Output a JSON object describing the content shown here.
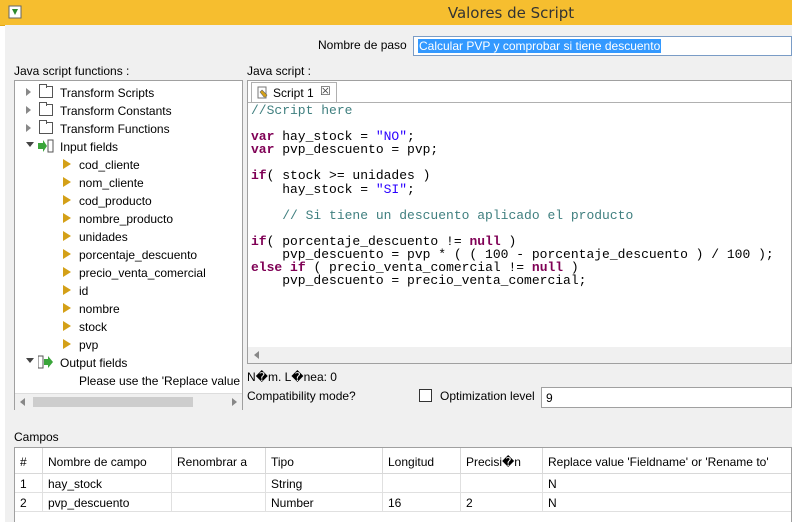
{
  "window": {
    "title": "Valores de Script"
  },
  "step": {
    "name_label": "Nombre de paso",
    "name_value": "Calcular PVP y comprobar si tiene descuento"
  },
  "functions": {
    "label": "Java script functions :",
    "tree": [
      {
        "label": "Transform Scripts",
        "kind": "folder"
      },
      {
        "label": "Transform Constants",
        "kind": "folder"
      },
      {
        "label": "Transform Functions",
        "kind": "folder"
      },
      {
        "label": "Input fields",
        "kind": "input"
      }
    ],
    "input_fields": [
      "cod_cliente",
      "nom_cliente",
      "cod_producto",
      "nombre_producto",
      "unidades",
      "porcentaje_descuento",
      "precio_venta_comercial",
      "id",
      "nombre",
      "stock",
      "pvp"
    ],
    "output_label": "Output fields",
    "output_note": "Please use the 'Replace value 'F"
  },
  "script": {
    "label": "Java script :",
    "tab_label": "Script 1",
    "lines": [
      "//Script here",
      "",
      "var hay_stock = \"NO\";",
      "var pvp_descuento = pvp;",
      "",
      "if( stock >= unidades )",
      "    hay_stock = \"SI\";",
      "",
      "    // Si tiene un descuento aplicado el producto",
      "",
      "if( porcentaje_descuento != null )",
      "    pvp_descuento = pvp * ( ( 100 - porcentaje_descuento ) / 100 );",
      "else if ( precio_venta_comercial != null )",
      "    pvp_descuento = precio_venta_comercial;"
    ],
    "line_number_label": "N�m. L�nea: 0"
  },
  "options": {
    "compat_label": "Compatibility mode?",
    "compat_checked": false,
    "opt_label": "Optimization level",
    "opt_value": "9"
  },
  "fields": {
    "label": "Campos",
    "columns": [
      "#",
      "Nombre de campo",
      "Renombrar a",
      "Tipo",
      "Longitud",
      "Precisi�n",
      "Replace value 'Fieldname' or 'Rename to'"
    ],
    "rows": [
      [
        "1",
        "hay_stock",
        "",
        "String",
        "",
        "",
        "N"
      ],
      [
        "2",
        "pvp_descuento",
        "",
        "Number",
        "16",
        "2",
        "N"
      ]
    ]
  },
  "colors": {
    "titlebar": "#f6be2f",
    "selection": "#3399ff",
    "keyword": "#7f0055",
    "comment": "#3f7f7f",
    "string": "#2a00ff"
  }
}
